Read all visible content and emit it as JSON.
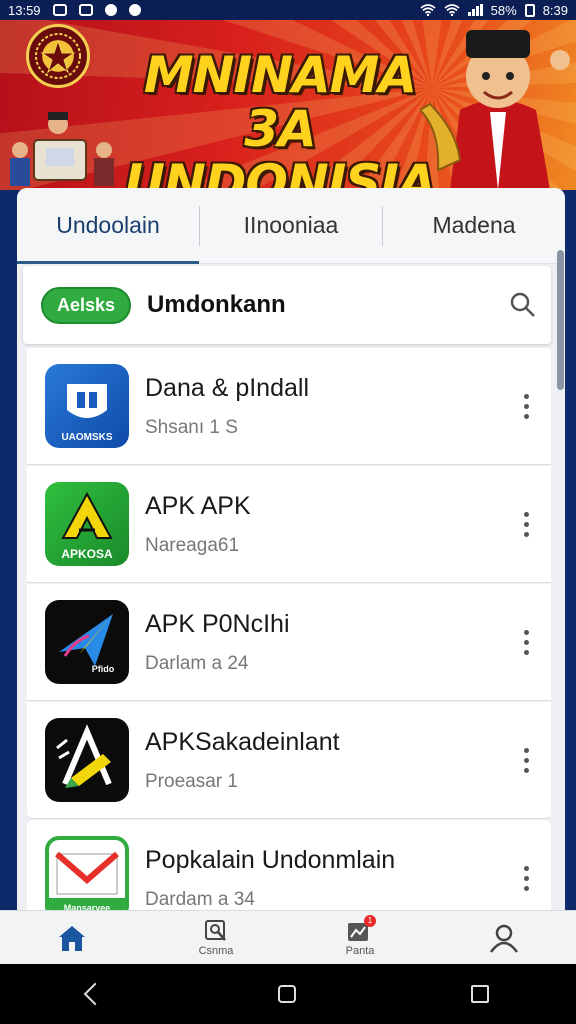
{
  "status_bar": {
    "time": "13:59",
    "battery": "58%",
    "clock_right": "8:39"
  },
  "banner": {
    "title_line1": "MNINAMA 3A",
    "title_line2": "UNDONISIA"
  },
  "tabs": [
    {
      "label": "Undoolain",
      "active": true
    },
    {
      "label": "IInooniaa",
      "active": false
    },
    {
      "label": "Madena",
      "active": false
    }
  ],
  "search": {
    "pill": "Aelsks",
    "title": "Umdonkann"
  },
  "apps": [
    {
      "name": "Dana & pIndall",
      "sub": "Shsanı 1 S",
      "icon_text": "UAOMSKS",
      "icon": "shield-app-icon"
    },
    {
      "name": "APK APK",
      "sub": "Nareaga61",
      "icon_text": "APKOSA",
      "icon": "triangle-a-icon"
    },
    {
      "name": "APK P0NcIhi",
      "sub": "Darlam a 24",
      "icon_text": "Pfido",
      "icon": "paper-plane-icon"
    },
    {
      "name": "APKSakadeinlant",
      "sub": "Proeasar 1",
      "icon_text": "",
      "icon": "pencil-a-icon"
    },
    {
      "name": "Popkalain Undonmlain",
      "sub": "Dardam a 34",
      "icon_text": "Mansaryee",
      "icon": "mail-icon"
    }
  ],
  "bottom_nav": [
    {
      "label": "",
      "icon": "home-icon",
      "active": true
    },
    {
      "label": "Csnma",
      "icon": "search-doc-icon"
    },
    {
      "label": "Panta",
      "icon": "chart-badge-icon",
      "badge": "1"
    },
    {
      "label": "",
      "icon": "profile-icon"
    }
  ],
  "colors": {
    "accent": "#1a56a0",
    "pill_green": "#2fab3f",
    "banner_red": "#d8201c",
    "banner_yellow": "#ffd21e"
  }
}
